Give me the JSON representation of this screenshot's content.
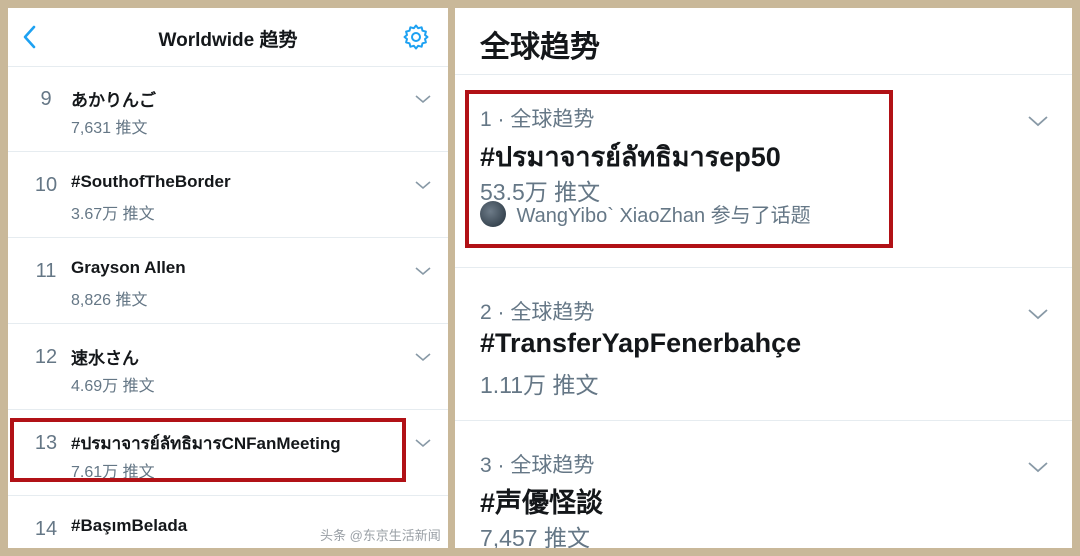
{
  "left": {
    "header": {
      "title": "Worldwide 趋势",
      "back_icon": "chevron-left-icon",
      "settings_icon": "gear-icon"
    },
    "trends": [
      {
        "rank": "9",
        "name": "あかりんご",
        "count": "7,631 推文"
      },
      {
        "rank": "10",
        "name": "#SouthofTheBorder",
        "count": "3.67万 推文"
      },
      {
        "rank": "11",
        "name": "Grayson Allen",
        "count": "8,826 推文"
      },
      {
        "rank": "12",
        "name": "速水さん",
        "count": "4.69万 推文"
      },
      {
        "rank": "13",
        "name": "#ปรมาจารย์ลัทธิมารCNFanMeeting",
        "count": "7.61万 推文"
      },
      {
        "rank": "14",
        "name": "#BaşımBelada",
        "count": ""
      }
    ],
    "watermark": "头条 @东京生活新闻"
  },
  "right": {
    "header": {
      "title": "全球趋势"
    },
    "trends": [
      {
        "meta": "1 · 全球趋势",
        "name": "#ปรมาจารย์ลัทธิมารep50",
        "count": "53.5万 推文",
        "participants": "WangYibo` XiaoZhan 参与了话题"
      },
      {
        "meta": "2 · 全球趋势",
        "name": "#TransferYapFenerbahçe",
        "count": "1.11万 推文"
      },
      {
        "meta": "3 · 全球趋势",
        "name": "#声優怪談",
        "count": "7,457 推文"
      }
    ]
  },
  "colors": {
    "frame": "#c9b899",
    "highlight": "#b11116",
    "accent": "#1da1f2",
    "secondary_text": "#657786"
  }
}
